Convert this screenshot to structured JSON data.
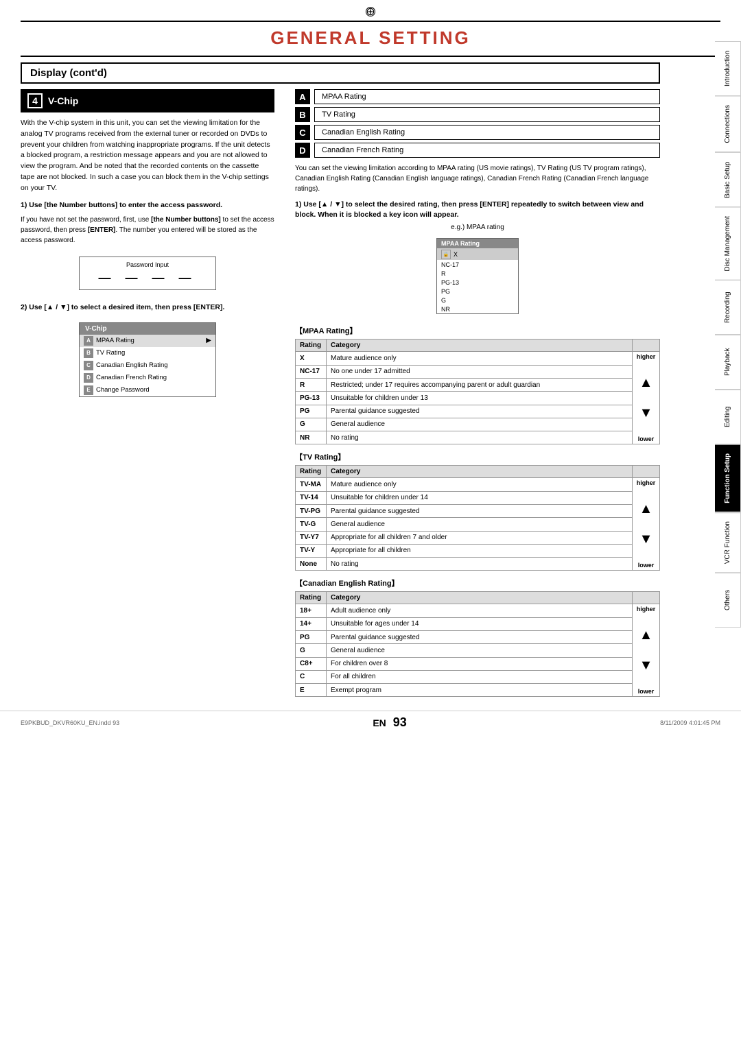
{
  "page": {
    "title": "GENERAL SETTING",
    "section": "Display (cont'd)",
    "page_number": "93",
    "en_label": "EN",
    "file_info": "E9PKBUD_DKVR60KU_EN.indd  93",
    "date_info": "8/11/2009  4:01:45 PM"
  },
  "side_tabs": [
    {
      "label": "Introduction",
      "active": false
    },
    {
      "label": "Connections",
      "active": false
    },
    {
      "label": "Basic Setup",
      "active": false
    },
    {
      "label": "Disc Management",
      "active": false
    },
    {
      "label": "Recording",
      "active": false
    },
    {
      "label": "Playback",
      "active": false
    },
    {
      "label": "Editing",
      "active": false
    },
    {
      "label": "Function Setup",
      "active": true
    },
    {
      "label": "VCR Function",
      "active": false
    },
    {
      "label": "Others",
      "active": false
    }
  ],
  "vchip_section": {
    "number": "4",
    "title": "V-Chip",
    "description": "With the V-chip system in this unit, you can set the viewing limitation for the analog TV programs received from the external tuner or recorded on DVDs to prevent your children from watching inappropriate programs. If the unit detects a blocked program, a restriction message appears and you are not allowed to view the program. And be noted that the recorded contents on the cassette tape are not blocked. In such a case you can block them in the V-chip settings on your TV."
  },
  "step1": {
    "header": "1) Use [the Number buttons] to enter the access password.",
    "body_before_bold": "If you have not set the password, first, use ",
    "bold1": "[the Number buttons]",
    "body_mid": " to set the access password, then press ",
    "bold2": "[ENTER]",
    "body_after": ". The number you entered will be stored as the access password.",
    "password_box": {
      "label": "Password Input",
      "display": "— — — —"
    }
  },
  "step2": {
    "header": "2) Use [▲ / ▼] to select a desired item, then press [ENTER].",
    "vchip_menu": {
      "title": "V-Chip",
      "items": [
        {
          "letter": "A",
          "label": "MPAA Rating",
          "has_arrow": true,
          "selected": true
        },
        {
          "letter": "B",
          "label": "TV Rating",
          "has_arrow": false
        },
        {
          "letter": "C",
          "label": "Canadian English Rating",
          "has_arrow": false
        },
        {
          "letter": "D",
          "label": "Canadian French Rating",
          "has_arrow": false
        },
        {
          "letter": "E",
          "label": "Change Password",
          "has_arrow": false
        }
      ]
    }
  },
  "right_column": {
    "ratings": [
      {
        "letter": "A",
        "label": "MPAA Rating"
      },
      {
        "letter": "B",
        "label": "TV Rating"
      },
      {
        "letter": "C",
        "label": "Canadian English Rating"
      },
      {
        "letter": "D",
        "label": "Canadian French Rating"
      }
    ],
    "info_text": "You can set the viewing limitation according to MPAA rating (US movie ratings), TV Rating (US TV program ratings), Canadian English Rating (Canadian English language ratings), Canadian French Rating (Canadian French language ratings).",
    "step_instruction": "1) Use [▲ / ▼] to select the desired rating, then press [ENTER] repeatedly to switch between view and block. When it is blocked a key icon will appear.",
    "eg_text": "e.g.) MPAA rating",
    "mpaa_menu": {
      "title": "MPAA Rating",
      "items": [
        {
          "icon": "lock",
          "label": "X",
          "selected": true
        },
        {
          "icon": null,
          "label": "NC-17"
        },
        {
          "icon": null,
          "label": "R"
        },
        {
          "icon": null,
          "label": "PG-13"
        },
        {
          "icon": null,
          "label": "PG"
        },
        {
          "icon": null,
          "label": "G"
        },
        {
          "icon": null,
          "label": "NR"
        }
      ]
    }
  },
  "mpaa_table": {
    "title": "【MPAA Rating】",
    "headers": [
      "Rating",
      "Category"
    ],
    "rows": [
      {
        "rating": "X",
        "category": "Mature audience only",
        "higher": true,
        "lower": false
      },
      {
        "rating": "NC-17",
        "category": "No one under 17 admitted",
        "higher": false,
        "lower": false
      },
      {
        "rating": "R",
        "category": "Restricted; under 17 requires accompanying parent or adult guardian",
        "higher": false,
        "lower": false
      },
      {
        "rating": "PG-13",
        "category": "Unsuitable for children under 13",
        "higher": false,
        "lower": false
      },
      {
        "rating": "PG",
        "category": "Parental guidance suggested",
        "higher": false,
        "lower": false
      },
      {
        "rating": "G",
        "category": "General audience",
        "higher": false,
        "lower": true
      },
      {
        "rating": "NR",
        "category": "No rating",
        "higher": false,
        "lower": false
      }
    ]
  },
  "tv_rating_table": {
    "title": "【TV Rating】",
    "headers": [
      "Rating",
      "Category"
    ],
    "rows": [
      {
        "rating": "TV-MA",
        "category": "Mature audience only",
        "higher": true,
        "lower": false
      },
      {
        "rating": "TV-14",
        "category": "Unsuitable for children under 14",
        "higher": false,
        "lower": false
      },
      {
        "rating": "TV-PG",
        "category": "Parental guidance suggested",
        "higher": false,
        "lower": false
      },
      {
        "rating": "TV-G",
        "category": "General audience",
        "higher": false,
        "lower": false
      },
      {
        "rating": "TV-Y7",
        "category": "Appropriate for all children 7 and older",
        "higher": false,
        "lower": false
      },
      {
        "rating": "TV-Y",
        "category": "Appropriate for all children",
        "higher": false,
        "lower": true
      },
      {
        "rating": "None",
        "category": "No rating",
        "higher": false,
        "lower": false
      }
    ]
  },
  "canadian_english_table": {
    "title": "【Canadian English Rating】",
    "headers": [
      "Rating",
      "Category"
    ],
    "rows": [
      {
        "rating": "18+",
        "category": "Adult audience only",
        "higher": true,
        "lower": false
      },
      {
        "rating": "14+",
        "category": "Unsuitable for ages under 14",
        "higher": false,
        "lower": false
      },
      {
        "rating": "PG",
        "category": "Parental guidance suggested",
        "higher": false,
        "lower": false
      },
      {
        "rating": "G",
        "category": "General audience",
        "higher": false,
        "lower": false
      },
      {
        "rating": "C8+",
        "category": "For children over 8",
        "higher": false,
        "lower": false
      },
      {
        "rating": "C",
        "category": "For all children",
        "higher": false,
        "lower": true
      },
      {
        "rating": "E",
        "category": "Exempt program",
        "higher": false,
        "lower": false
      }
    ]
  },
  "labels": {
    "higher": "higher",
    "lower": "lower"
  }
}
